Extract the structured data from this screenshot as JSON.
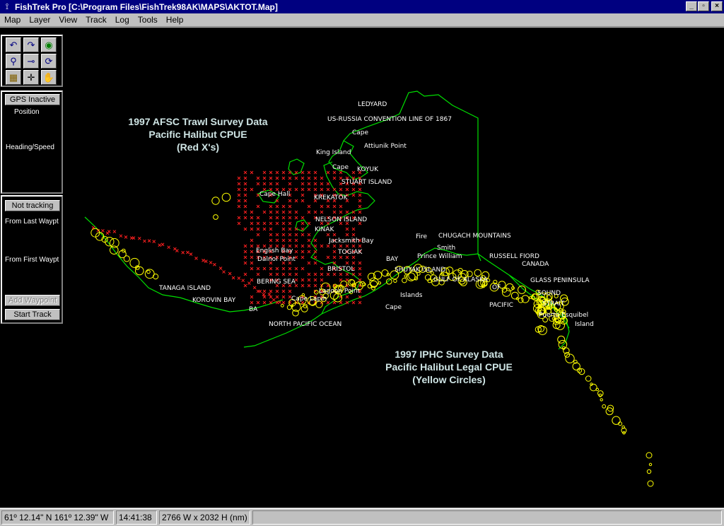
{
  "window": {
    "title": "FishTrek Pro [C:\\Program Files\\FishTrek98AK\\MAPS\\AKTOT.Map]",
    "app_icon": "fish-icon",
    "controls": [
      "minimize-icon",
      "maximize-icon",
      "close-icon"
    ]
  },
  "menu": [
    "Map",
    "Layer",
    "View",
    "Track",
    "Log",
    "Tools",
    "Help"
  ],
  "toolbox": {
    "tools": [
      "undo-icon",
      "redo-icon",
      "globe-icon",
      "zoom-icon",
      "measure-icon",
      "refresh-icon",
      "grid-icon",
      "crosshair-icon",
      "pan-hand-icon"
    ]
  },
  "gps_panel": {
    "button": "GPS Inactive",
    "position_label": "Position",
    "heading_label": "Heading/Speed"
  },
  "track_panel": {
    "button": "Not tracking",
    "from_last": "From Last Waypt",
    "from_first": "From First Waypt",
    "add_waypoint": "Add Waypoint",
    "start_track": "Start Track"
  },
  "captions": {
    "afsc": [
      "1997 AFSC Trawl Survey Data",
      "Pacific Halibut CPUE",
      "(Red X's)"
    ],
    "iphc": [
      "1997 IPHC Survey Data",
      "Pacific Halibut Legal CPUE",
      "(Yellow Circles)"
    ]
  },
  "map_labels": {
    "ledyard": "LEDYARD",
    "convention": "US-RUSSIA CONVENTION LINE OF 1867",
    "cape1": "Cape",
    "attiunik": "Attiunik Point",
    "king_island": "King Island",
    "cape2": "Cape",
    "koyuk": "KOYUK",
    "stuart": "STUART ISLAND",
    "krekatok": "KREKATOK",
    "cape_hall": "Cape Hall",
    "nelson": "NELSON ISLAND",
    "kinak": "KINAK",
    "jacksmith": "Jacksmith Bay",
    "togiak": "TOGIAK",
    "english_bay": "English Bay",
    "dalnoi": "Dalnoi Point",
    "bristol": "BRISTOL",
    "bay": "BAY",
    "bering_sea": "BERING SEA",
    "lagoon_point": "Lagoon Point",
    "cape_lapin": "Cape Lapin",
    "tanaga": "TANAGA ISLAND",
    "korovin": "KOROVIN BAY",
    "ba": "BA",
    "north_pacific": "NORTH PACIFIC OCEAN",
    "fire": "Fire",
    "chugach": "CHUGACH MOUNTAINS",
    "smith": "Smith",
    "russell": "RUSSELL FIORD",
    "canada": "CANADA",
    "gulf_alaska": "GULF OF ALASKA",
    "glass": "GLASS PENINSULA",
    "sound": "SOUND",
    "pacific": "PACIFIC",
    "strait": "STRAIT",
    "esquibel": "Puerto Esquibel",
    "island": "Island",
    "islands": "Islands",
    "cape3": "Cape",
    "kodiak_partial": "SHUYAK ISLAND",
    "prince": "Prince William",
    "of": "OF"
  },
  "status": {
    "coords": "61º 12.14\" N 161º 12.39\" W",
    "time": "14:41:38",
    "extent": "2766 W x 2032 H (nm)",
    "message": ""
  },
  "colors": {
    "land_outline": "#00ff00",
    "trawl_marks": "#ff2020",
    "iphc_circles": "#ffff00",
    "background": "#000000"
  }
}
